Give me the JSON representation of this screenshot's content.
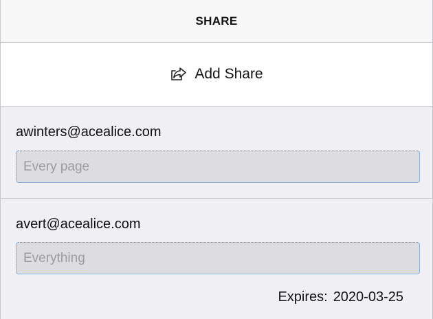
{
  "header": {
    "title": "SHARE"
  },
  "add_share": {
    "icon": "share-arrow-icon",
    "label": "Add Share"
  },
  "shares": [
    {
      "email": "awinters@acealice.com",
      "scope_placeholder": "Every page",
      "scope_value": ""
    },
    {
      "email": "avert@acealice.com",
      "scope_placeholder": "Everything",
      "scope_value": "",
      "expires_label": "Expires:",
      "expires_date": "2020-03-25"
    }
  ],
  "colors": {
    "focus_border": "#2d8ce6",
    "input_bg": "#dddde1",
    "panel_bg": "#efeff4",
    "header_bg": "#f7f7f7"
  }
}
